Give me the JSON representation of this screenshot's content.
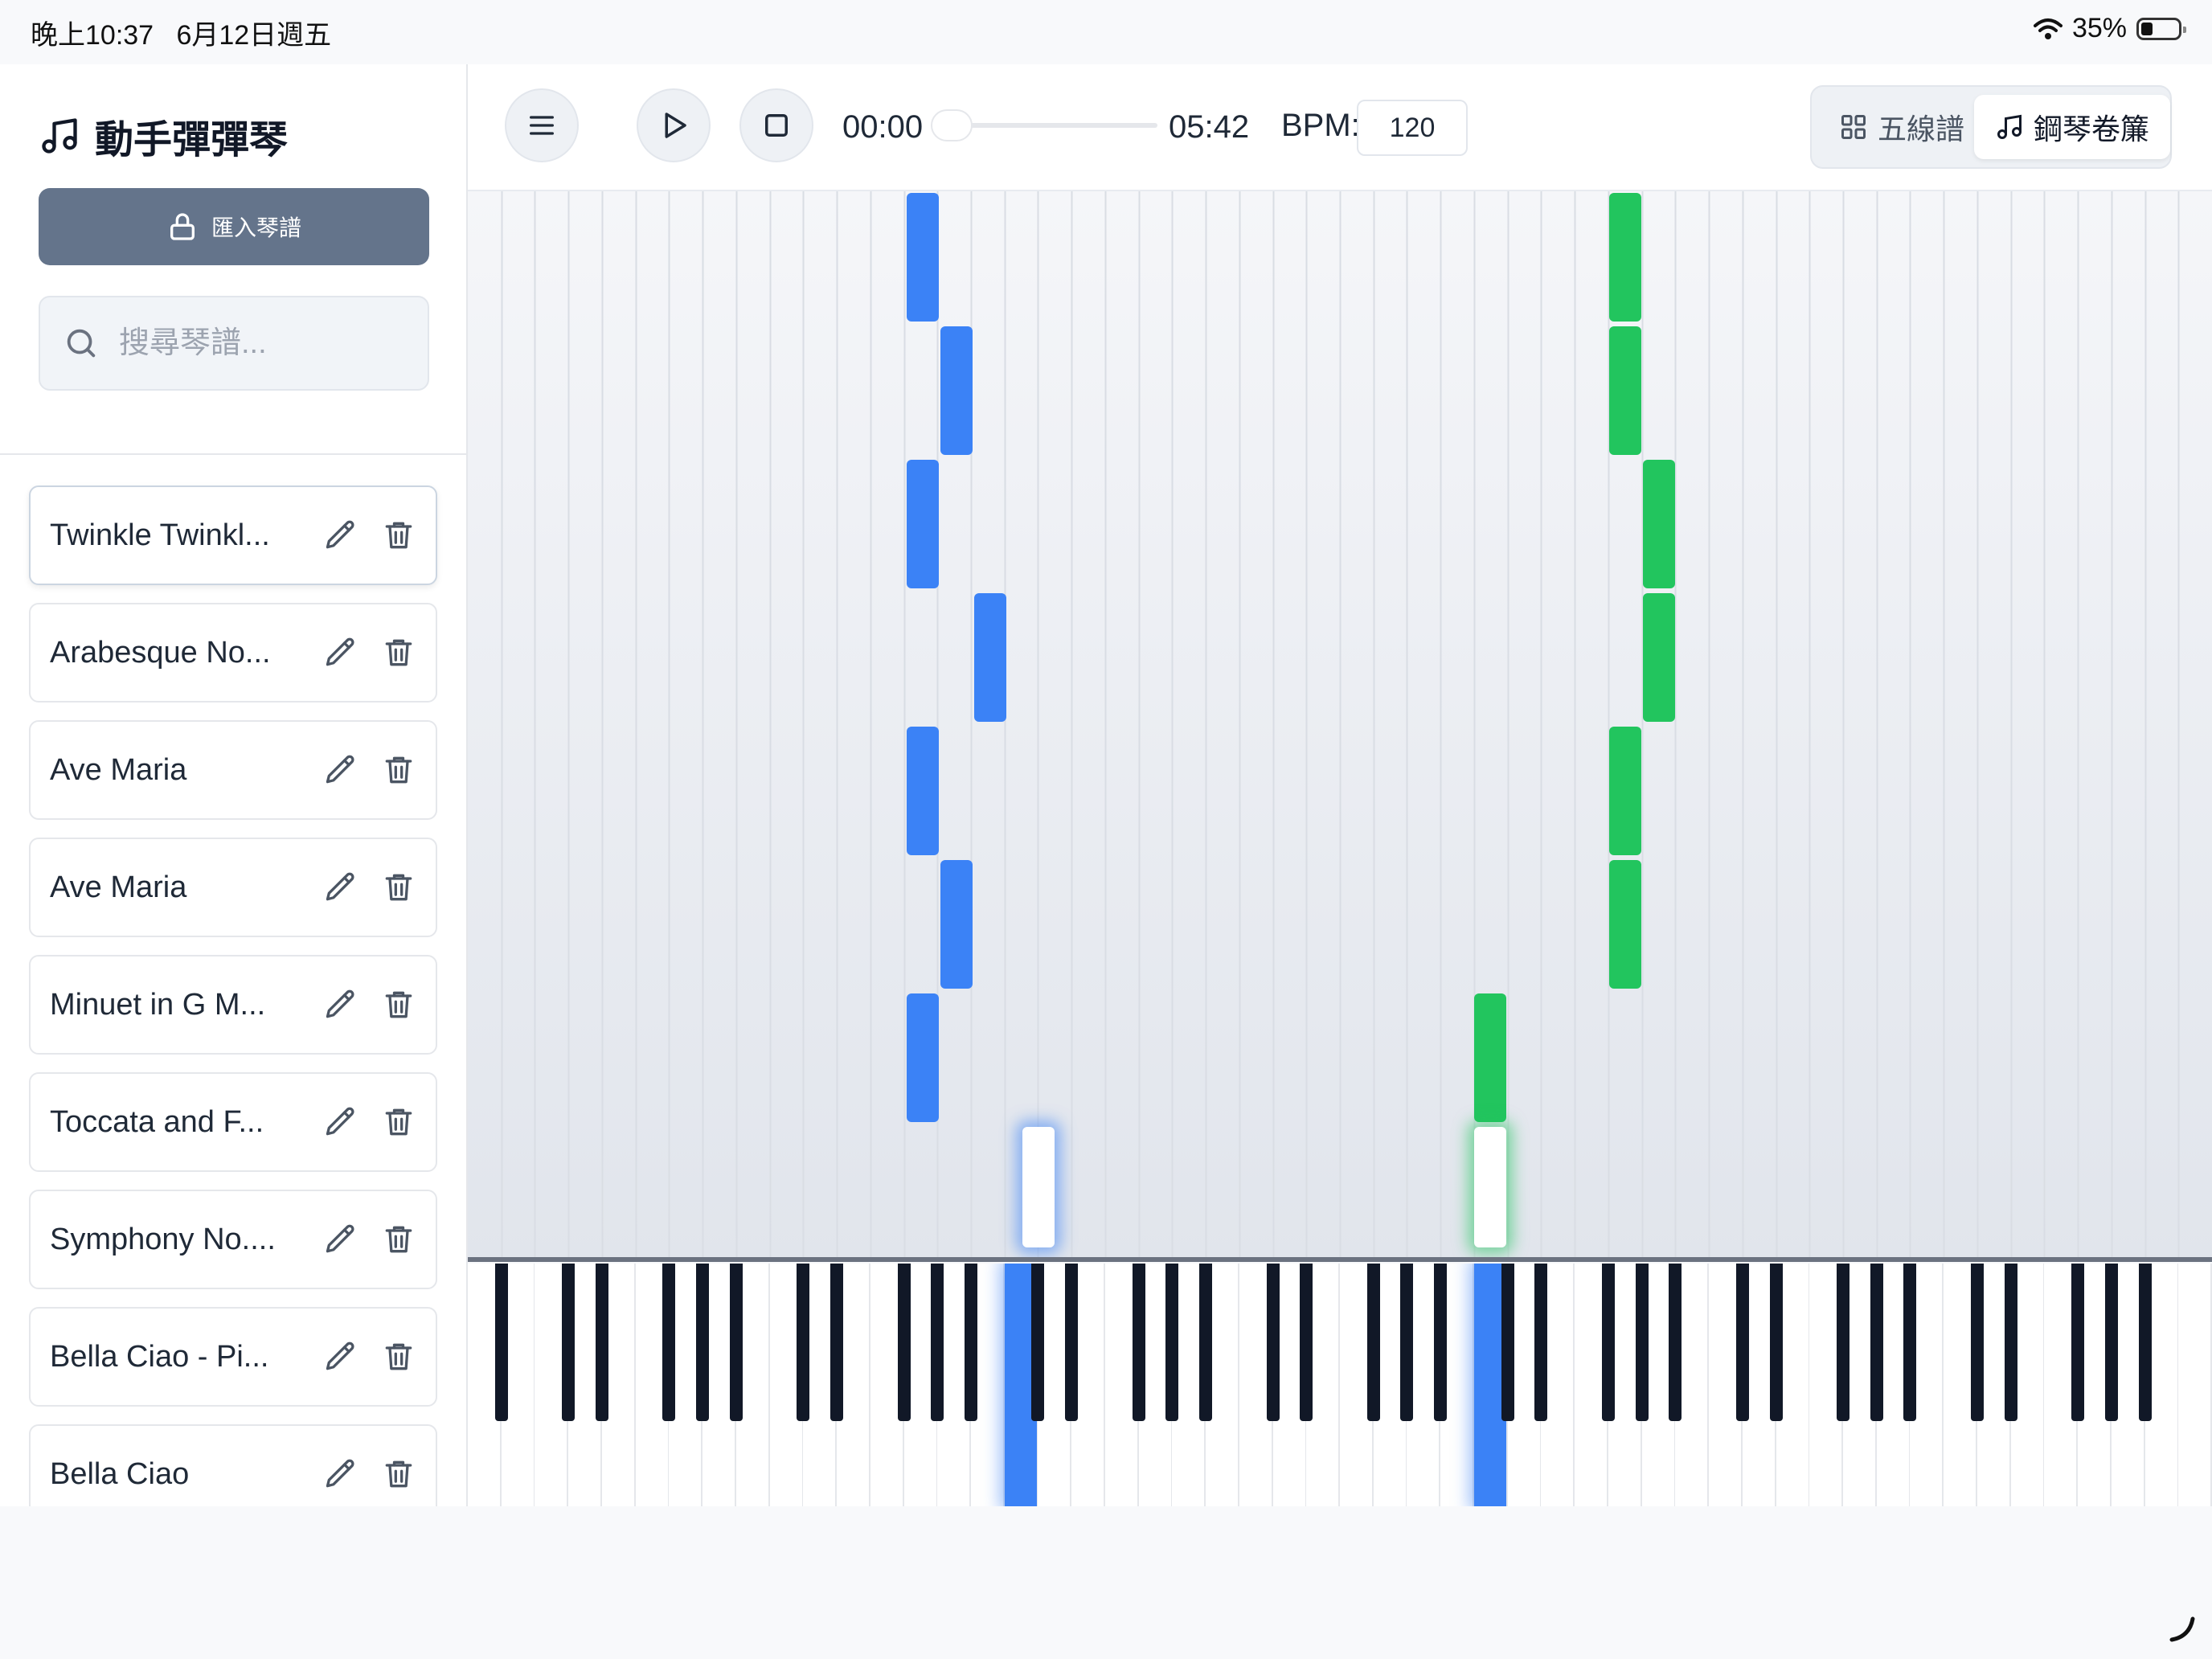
{
  "status_bar": {
    "time": "晚上10:37",
    "date": "6月12日週五",
    "battery": "35%"
  },
  "sidebar": {
    "app_title": "動手彈彈琴",
    "import_label": "匯入琴譜",
    "search_placeholder": "搜尋琴譜...",
    "songs": [
      {
        "title": "Twinkle Twinkl..."
      },
      {
        "title": "Arabesque No..."
      },
      {
        "title": "Ave Maria"
      },
      {
        "title": "Ave Maria"
      },
      {
        "title": "Minuet in G M..."
      },
      {
        "title": "Toccata and F..."
      },
      {
        "title": "Symphony No...."
      },
      {
        "title": "Bella Ciao - Pi..."
      },
      {
        "title": "Bella Ciao"
      }
    ]
  },
  "toolbar": {
    "time_current": "00:00",
    "time_total": "05:42",
    "progress": 0,
    "bpm_label": "BPM:",
    "bpm_value": "120",
    "view_staff": "五線譜",
    "view_roll": "鋼琴卷簾"
  },
  "colors": {
    "right_hand": "#3b82f6",
    "left_hand": "#22c55e",
    "accent": "#64748b"
  },
  "icons": [
    "music-note-icon",
    "lock-icon",
    "search-icon",
    "pencil-icon",
    "trash-icon",
    "menu-icon",
    "play-icon",
    "stop-icon",
    "grid-icon",
    "wifi-icon",
    "battery-icon"
  ]
}
